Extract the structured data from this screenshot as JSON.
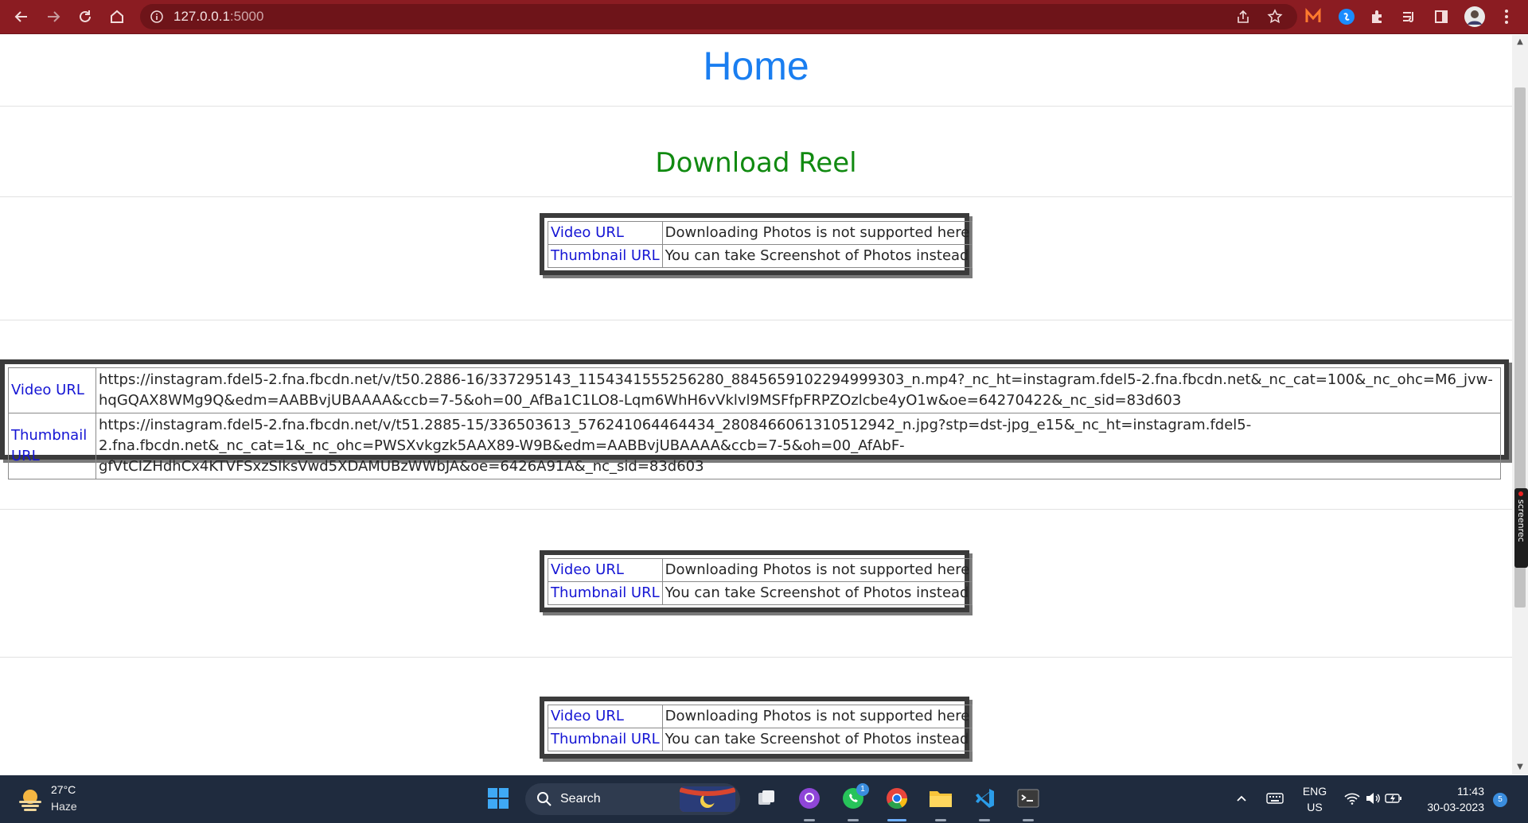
{
  "browser": {
    "url_host": "127.0.0.1",
    "url_port": ":5000"
  },
  "page": {
    "title": "Home",
    "subtitle": "Download Reel",
    "tables": [
      {
        "video_label": "Video URL",
        "video_value": "Downloading Photos is not supported here",
        "thumb_label": "Thumbnail URL",
        "thumb_value": "You can take Screenshot of Photos instead"
      },
      {
        "video_label": "Video URL",
        "video_value": "https://instagram.fdel5-2.fna.fbcdn.net/v/t50.2886-16/337295143_1154341555256280_8845659102294999303_n.mp4?_nc_ht=instagram.fdel5-2.fna.fbcdn.net&_nc_cat=100&_nc_ohc=M6_jvw-hqGQAX8WMg9Q&edm=AABBvjUBAAAA&ccb=7-5&oh=00_AfBa1C1LO8-Lqm6WhH6vVklvl9MSFfpFRPZOzlcbe4yO1w&oe=64270422&_nc_sid=83d603",
        "thumb_label": "Thumbnail URL",
        "thumb_value": "https://instagram.fdel5-2.fna.fbcdn.net/v/t51.2885-15/336503613_576241064464434_2808466061310512942_n.jpg?stp=dst-jpg_e15&_nc_ht=instagram.fdel5-2.fna.fbcdn.net&_nc_cat=1&_nc_ohc=PWSXvkgzk5AAX89-W9B&edm=AABBvjUBAAAA&ccb=7-5&oh=00_AfAbF-gfVtCIZHdhCx4KTVFSxzSIksVwd5XDAMUBzWWbJA&oe=6426A91A&_nc_sid=83d603"
      },
      {
        "video_label": "Video URL",
        "video_value": "Downloading Photos is not supported here",
        "thumb_label": "Thumbnail URL",
        "thumb_value": "You can take Screenshot of Photos instead"
      },
      {
        "video_label": "Video URL",
        "video_value": "Downloading Photos is not supported here",
        "thumb_label": "Thumbnail URL",
        "thumb_value": "You can take Screenshot of Photos instead"
      }
    ]
  },
  "screenrec": "screenrec",
  "taskbar": {
    "weather_temp": "27°C",
    "weather_desc": "Haze",
    "search_label": "Search",
    "whatsapp_badge": "1",
    "lang_top": "ENG",
    "lang_bottom": "US",
    "time": "11:43",
    "date": "30-03-2023",
    "notif_count": "5"
  },
  "colors": {
    "toolbar_bg": "#8b1c22",
    "title_color": "#1a7ef0",
    "subtitle_color": "#118a11",
    "link_color": "#1515d4",
    "taskbar_bg": "#1f2b3e"
  }
}
